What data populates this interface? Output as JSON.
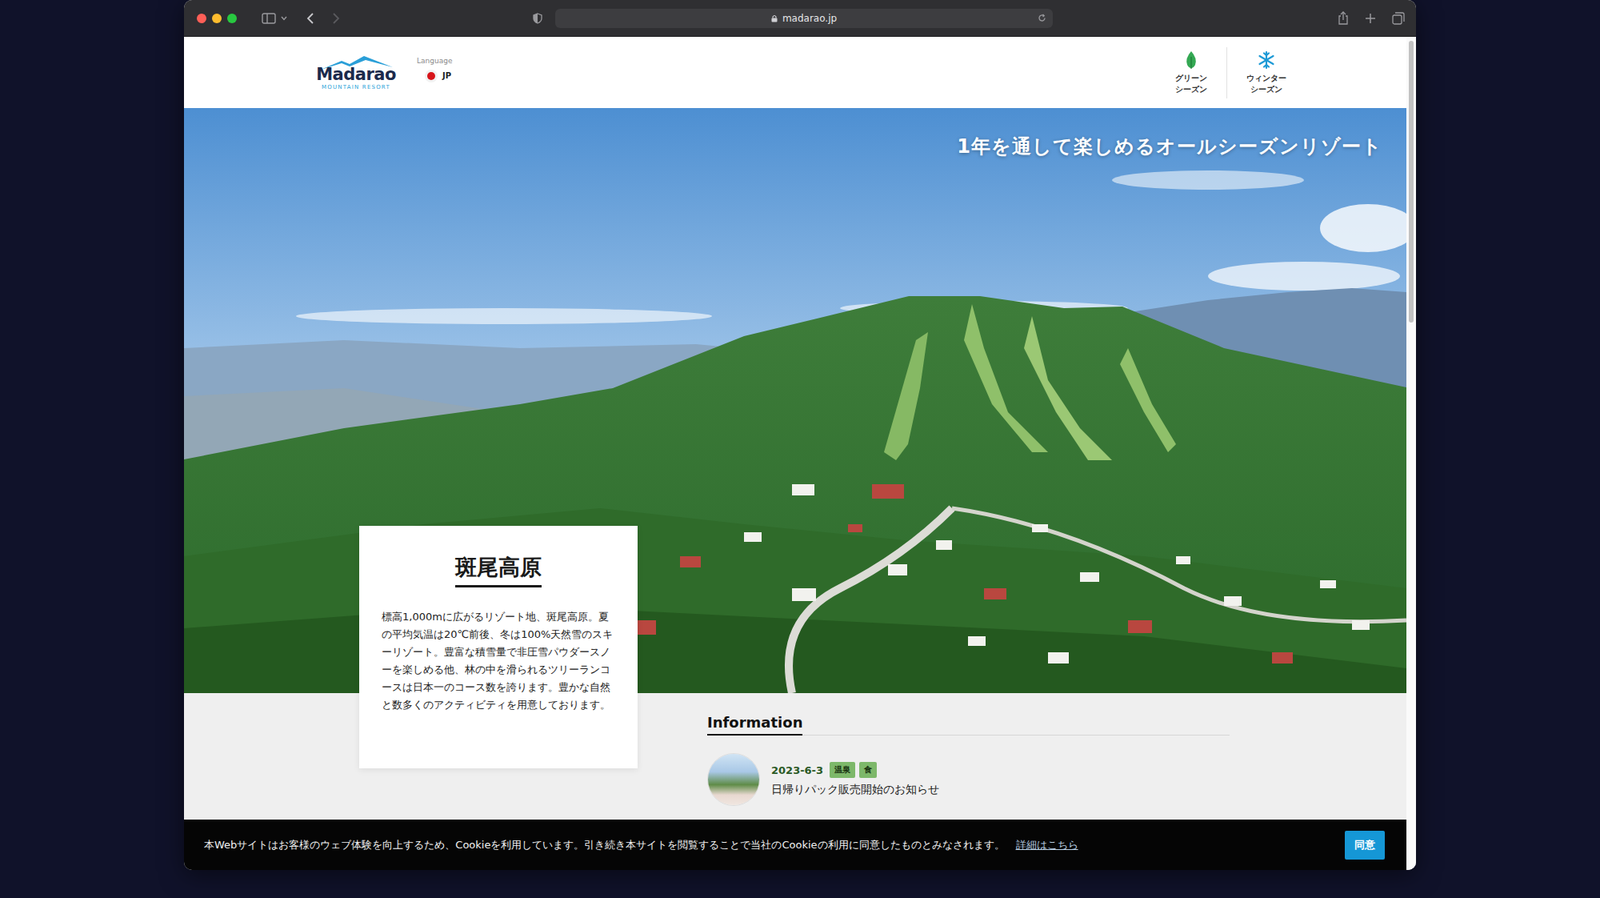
{
  "browser": {
    "url": "madarao.jp",
    "back_enabled": true,
    "forward_enabled": false
  },
  "header": {
    "logo": {
      "name": "Madarao",
      "subtitle": "MOUNTAIN RESORT"
    },
    "language": {
      "label": "Language",
      "current": "JP"
    },
    "seasons": [
      {
        "lines": [
          "グリーン",
          "シーズン"
        ],
        "kind": "leaf"
      },
      {
        "lines": [
          "ウィンター",
          "シーズン"
        ],
        "kind": "snow"
      }
    ]
  },
  "hero": {
    "tagline": "1年を通して楽しめるオールシーズンリゾート"
  },
  "intro_card": {
    "title": "斑尾高原",
    "body": "標高1,000mに広がるリゾート地、斑尾高原。夏の平均気温は20℃前後、冬は100%天然雪のスキーリゾート。豊富な積雪量で非圧雪パウダースノーを楽しめる他、林の中を滑られるツリーランコースは日本一のコース数を誇ります。豊かな自然と数多くのアクティビティを用意しております。"
  },
  "information": {
    "heading": "Information",
    "items": [
      {
        "date": "2023-6-3",
        "tags": [
          "温泉",
          "食"
        ],
        "title": "日帰りパック販売開始のお知らせ"
      }
    ]
  },
  "cookie_banner": {
    "text": "本Webサイトはお客様のウェブ体験を向上するため、Cookieを利用しています。引き続き本サイトを閲覧することで当社のCookieの利用に同意したものとみなされます。",
    "link": "詳細はこちら",
    "button": "同意"
  }
}
